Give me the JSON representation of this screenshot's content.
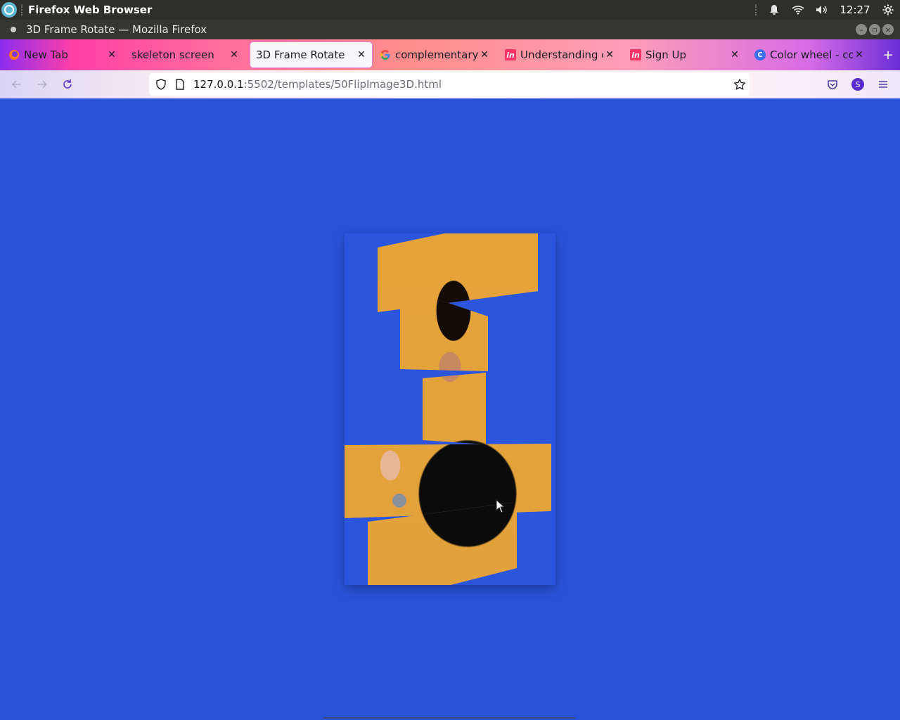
{
  "system": {
    "app_name": "Firefox Web Browser",
    "clock": "12:27",
    "icons": [
      "bell-icon",
      "wifi-icon",
      "volume-icon",
      "settings-icon"
    ]
  },
  "window": {
    "title": "3D Frame Rotate — Mozilla Firefox"
  },
  "tabs": [
    {
      "label": "New Tab",
      "favicon": "firefox-icon",
      "active": false
    },
    {
      "label": "skeleton screen",
      "favicon": "",
      "active": false
    },
    {
      "label": "3D Frame Rotate",
      "favicon": "",
      "active": true
    },
    {
      "label": "complementary co",
      "favicon": "google-icon",
      "active": false
    },
    {
      "label": "Understanding col",
      "favicon": "invision-icon",
      "active": false
    },
    {
      "label": "Sign Up",
      "favicon": "invision-icon",
      "active": false
    },
    {
      "label": "Color wheel - colo",
      "favicon": "canva-icon",
      "active": false
    }
  ],
  "navbar": {
    "url_host": "127.0.0.1",
    "url_path": ":5502/templates/50FlipImage3D.html",
    "profile_initial": "S"
  },
  "page": {
    "background": "#2852d8",
    "image_description_icon": "portrait-photo-icon"
  },
  "colors": {
    "page_bg": "#2852d8",
    "photo_bg": "#e5a33a",
    "topbar": "#2e2e2b"
  }
}
